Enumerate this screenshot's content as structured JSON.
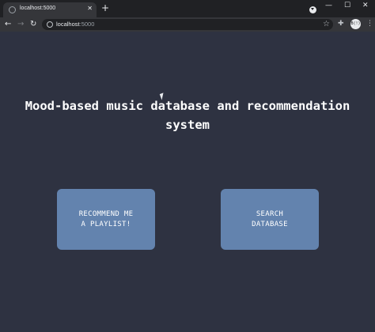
{
  "browser": {
    "tab": {
      "title": "localhost:5000",
      "close": "✕"
    },
    "new_tab": "+",
    "window_controls": {
      "minimize": "—",
      "maximize": "☐",
      "close": "✕"
    },
    "toolbar": {
      "back": "←",
      "forward": "→",
      "reload": "↻",
      "star": "☆",
      "extensions": "✚",
      "menu": "⋮"
    },
    "address": {
      "host": "localhost",
      "port": ":5000"
    },
    "profile_label": "B(!)"
  },
  "page": {
    "title": "Mood-based music database and recommendation system",
    "buttons": {
      "recommend": "RECOMMEND ME\nA PLAYLIST!",
      "search": "SEARCH\nDATABASE"
    }
  },
  "colors": {
    "background": "#2e3241",
    "button": "#6383ae",
    "chrome_dark": "#202124",
    "chrome_toolbar": "#35363a"
  }
}
